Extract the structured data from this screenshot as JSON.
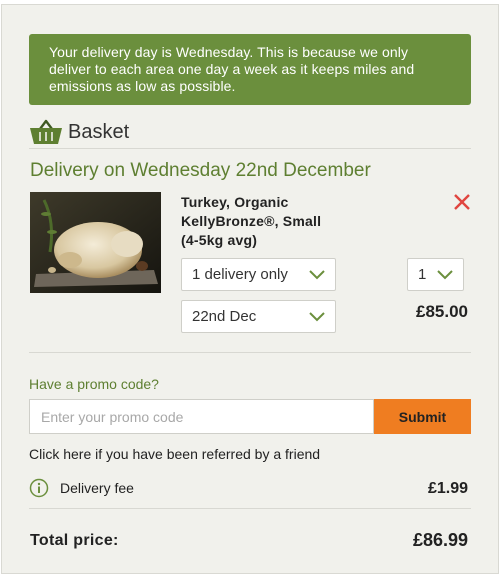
{
  "notice": {
    "lines": [
      "Your delivery day is Wednesday. This is because we only",
      "deliver to each area one day a week as it keeps miles and",
      "emissions as low as possible."
    ]
  },
  "basket": {
    "title": "Basket",
    "icon": "basket-icon"
  },
  "delivery": {
    "title": "Delivery on Wednesday 22nd December"
  },
  "item": {
    "name_lines": [
      "Turkey, Organic",
      "KellyBronze®, Small",
      "(4-5kg avg)"
    ],
    "frequency": "1 delivery only",
    "date": "22nd Dec",
    "quantity": "1",
    "price": "£85.00",
    "remove_icon": "close-icon",
    "image_alt": "Organic KellyBronze turkey"
  },
  "promo": {
    "label": "Have a promo code?",
    "placeholder": "Enter your promo code",
    "value": "",
    "submit": "Submit"
  },
  "referral": "Click here if you have been referred by a friend",
  "fees": {
    "delivery_label": "Delivery fee",
    "delivery_value": "£1.99",
    "info_icon": "info-icon"
  },
  "total": {
    "label": "Total price:",
    "value": "£86.99"
  },
  "colors": {
    "notice_bg": "#6b8f3d",
    "accent_green": "#5e7f31",
    "submit_orange": "#ef7d21",
    "remove_red": "#e0453f",
    "panel_bg": "#f1f1ec"
  }
}
